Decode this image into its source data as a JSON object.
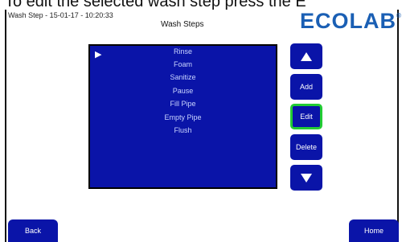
{
  "caption": "To edit the selected wash step press the E",
  "header": {
    "stamp": "Wash Step - 15-01-17 - 10:20:33",
    "title": "Wash Steps",
    "logo": "ECOLAB",
    "logo_mark": "®"
  },
  "steps": [
    "Rinse",
    "Foam",
    "Sanitize",
    "Pause",
    "Fill Pipe",
    "Empty Pipe",
    "Flush"
  ],
  "selected_step_index": 0,
  "side_buttons": {
    "up_icon": "arrow-up-icon",
    "add": "Add",
    "edit": "Edit",
    "delete": "Delete",
    "down_icon": "arrow-down-icon"
  },
  "footer": {
    "back": "Back",
    "home": "Home"
  },
  "colors": {
    "panel_blue": "#0a14a8",
    "logo_blue": "#1a5fb4",
    "selected_border": "#22cc33"
  }
}
